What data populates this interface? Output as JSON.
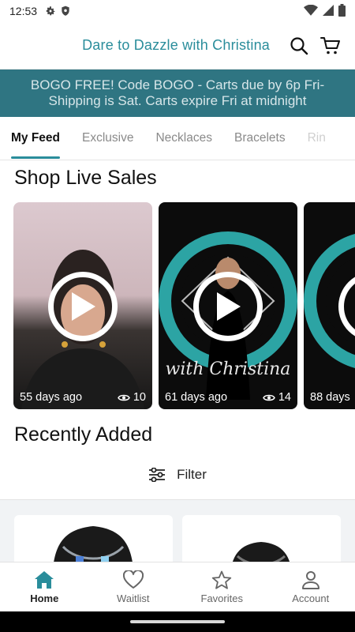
{
  "status_bar": {
    "time": "12:53",
    "icons": [
      "gear-icon",
      "shield-icon",
      "wifi-icon",
      "cellular-icon",
      "battery-icon"
    ]
  },
  "header": {
    "title": "Dare to Dazzle with Christina",
    "title_color": "#2a8d9b",
    "icons": [
      "search-icon",
      "cart-icon"
    ]
  },
  "promo": {
    "line1": "BOGO FREE! Code BOGO - Carts due by 6p Fri-",
    "line2": "Shipping is Sat. Carts expire Fri at midnight",
    "background": "#2f7582"
  },
  "tabs": [
    {
      "label": "My Feed",
      "active": true
    },
    {
      "label": "Exclusive"
    },
    {
      "label": "Necklaces"
    },
    {
      "label": "Bracelets"
    },
    {
      "label": "Rin"
    }
  ],
  "live_sales": {
    "title": "Shop Live Sales",
    "cards": [
      {
        "age": "55 days ago",
        "views": "10"
      },
      {
        "age": "61 days ago",
        "views": "14",
        "overlay_text": "with Christina"
      },
      {
        "age": "88 days"
      }
    ]
  },
  "recently_added": {
    "title": "Recently Added",
    "filter_label": "Filter"
  },
  "bottom_nav": [
    {
      "label": "Home",
      "icon": "home-icon",
      "active": true
    },
    {
      "label": "Waitlist",
      "icon": "heart-icon"
    },
    {
      "label": "Favorites",
      "icon": "star-icon"
    },
    {
      "label": "Account",
      "icon": "person-icon"
    }
  ],
  "accent_color": "#2a8d9b"
}
